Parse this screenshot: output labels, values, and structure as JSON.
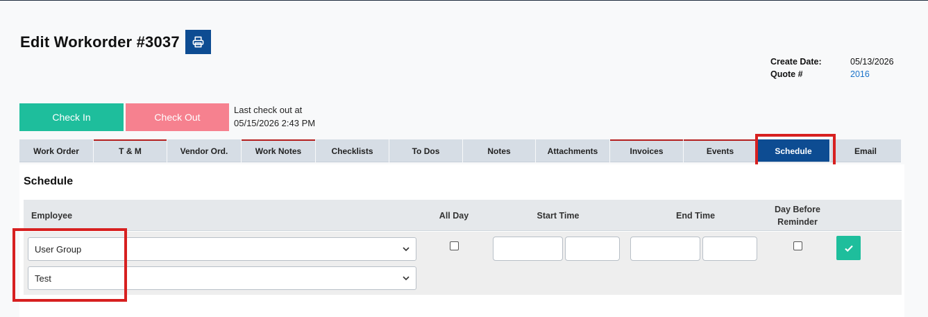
{
  "header": {
    "title": "Edit Workorder #3037",
    "print_icon": "printer-icon"
  },
  "meta": {
    "create_date_label": "Create Date:",
    "create_date_value": "05/13/2026",
    "quote_label": "Quote #",
    "quote_value": "2016"
  },
  "actions": {
    "check_in": "Check In",
    "check_out": "Check Out",
    "last_check_line1": "Last check out at",
    "last_check_line2": "05/15/2026 2:43 PM"
  },
  "tabs": [
    {
      "label": "Work Order"
    },
    {
      "label": "T & M"
    },
    {
      "label": "Vendor Ord."
    },
    {
      "label": "Work Notes"
    },
    {
      "label": "Checklists"
    },
    {
      "label": "To Dos"
    },
    {
      "label": "Notes"
    },
    {
      "label": "Attachments"
    },
    {
      "label": "Invoices"
    },
    {
      "label": "Events"
    },
    {
      "label": "Schedule",
      "active": true
    },
    {
      "label": "Email"
    }
  ],
  "schedule": {
    "title": "Schedule",
    "columns": {
      "employee": "Employee",
      "all_day": "All Day",
      "start_time": "Start Time",
      "end_time": "End Time",
      "reminder_line1": "Day Before",
      "reminder_line2": "Reminder"
    },
    "user_group_select": "User Group",
    "employee_select": "Test",
    "all_day_checked": false,
    "reminder_checked": false
  },
  "colors": {
    "primary": "#0d4c92",
    "success": "#1ebe9c",
    "danger_light": "#f6818f",
    "highlight": "#d72020"
  }
}
